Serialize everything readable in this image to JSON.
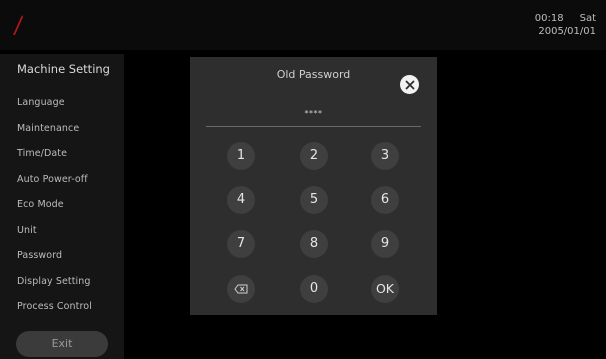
{
  "header": {
    "time": "00:18",
    "day": "Sat",
    "date": "2005/01/01",
    "logo_color": "#b01818"
  },
  "sidebar": {
    "title": "Machine Setting",
    "items": [
      {
        "label": "Language"
      },
      {
        "label": "Maintenance"
      },
      {
        "label": "Time/Date"
      },
      {
        "label": "Auto Power-off"
      },
      {
        "label": "Eco Mode"
      },
      {
        "label": "Unit"
      },
      {
        "label": "Password"
      },
      {
        "label": "Display Setting"
      },
      {
        "label": "Process Control"
      }
    ],
    "exit_label": "Exit"
  },
  "dialog": {
    "title": "Old Password",
    "close_icon": "close-icon",
    "password_value": "****",
    "keys": [
      {
        "label": "1"
      },
      {
        "label": "2"
      },
      {
        "label": "3"
      },
      {
        "label": "4"
      },
      {
        "label": "5"
      },
      {
        "label": "6"
      },
      {
        "label": "7"
      },
      {
        "label": "8"
      },
      {
        "label": "9"
      },
      {
        "icon": "backspace-icon"
      },
      {
        "label": "0"
      },
      {
        "label": "OK"
      }
    ]
  }
}
